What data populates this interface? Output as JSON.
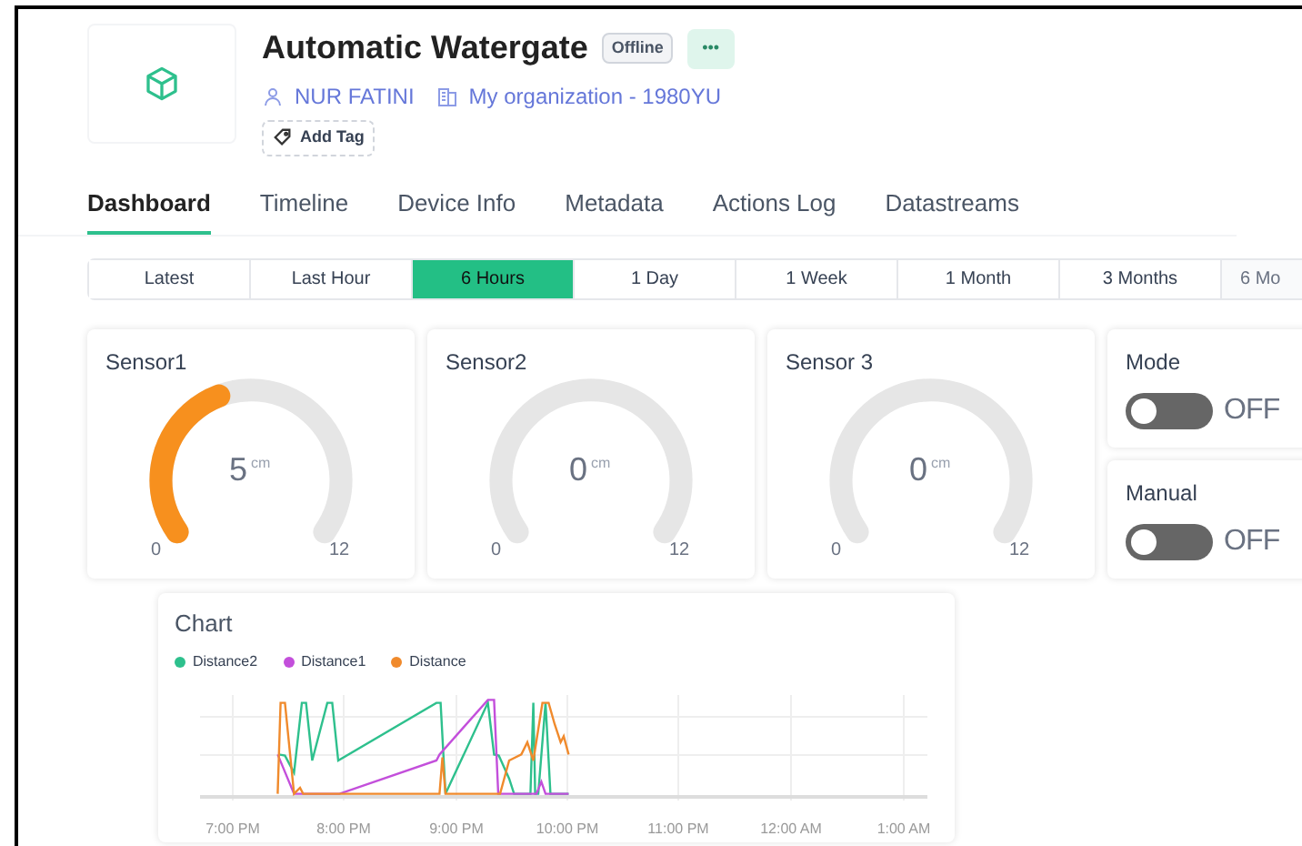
{
  "device": {
    "title": "Automatic Watergate",
    "status": "Offline",
    "owner": "NUR FATINI",
    "organization": "My organization - 1980YU",
    "add_tag": "Add Tag",
    "more": "•••"
  },
  "tabs": [
    {
      "label": "Dashboard",
      "selected": true
    },
    {
      "label": "Timeline",
      "selected": false
    },
    {
      "label": "Device Info",
      "selected": false
    },
    {
      "label": "Metadata",
      "selected": false
    },
    {
      "label": "Actions Log",
      "selected": false
    },
    {
      "label": "Datastreams",
      "selected": false
    }
  ],
  "time_ranges": [
    {
      "label": "Latest",
      "selected": false
    },
    {
      "label": "Last Hour",
      "selected": false
    },
    {
      "label": "6 Hours",
      "selected": true
    },
    {
      "label": "1 Day",
      "selected": false
    },
    {
      "label": "1 Week",
      "selected": false
    },
    {
      "label": "1 Month",
      "selected": false
    },
    {
      "label": "3 Months",
      "selected": false
    },
    {
      "label": "6 Mo",
      "selected": false
    }
  ],
  "gauges": [
    {
      "title": "Sensor1",
      "value": "5",
      "unit": "cm",
      "min": "0",
      "max": "12"
    },
    {
      "title": "Sensor2",
      "value": "0",
      "unit": "cm",
      "min": "0",
      "max": "12"
    },
    {
      "title": "Sensor 3",
      "value": "0",
      "unit": "cm",
      "min": "0",
      "max": "12"
    }
  ],
  "switches": [
    {
      "title": "Mode",
      "state": "OFF",
      "on": false
    },
    {
      "title": "Manual",
      "state": "OFF",
      "on": false
    }
  ],
  "chart": {
    "title": "Chart",
    "legend": [
      {
        "name": "Distance2",
        "color": "#2ec08d"
      },
      {
        "name": "Distance1",
        "color": "#c34fdb"
      },
      {
        "name": "Distance",
        "color": "#f08a2c"
      }
    ],
    "x_labels": [
      "7:00 PM",
      "8:00 PM",
      "9:00 PM",
      "10:00 PM",
      "11:00 PM",
      "12:00 AM",
      "1:00 AM"
    ]
  }
}
